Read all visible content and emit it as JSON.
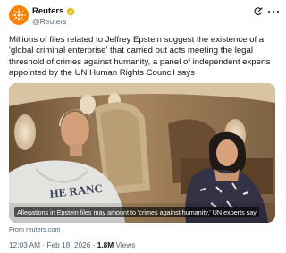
{
  "author": {
    "name": "Reuters",
    "handle": "@Reuters",
    "brand_color": "#ff8000",
    "verified_color": "#e2b719"
  },
  "tweet": {
    "line1": "Millions of files related to Jeffrey Epstein suggest the existence of a",
    "line2": "'global criminal enterprise' that carried out acts meeting the legal",
    "line3": "threshold of crimes against humanity, a panel of independent experts",
    "line4": "appointed by the UN Human Rights Council says"
  },
  "media": {
    "caption": "Allegations in Epstein files may amount to 'crimes against humanity,' UN experts say",
    "source": "From reuters.com",
    "shirt_text": "HE RANC"
  },
  "meta": {
    "time": "12:03 AM",
    "sep1": " · ",
    "date": "Feb 18, 2026",
    "sep2": " · ",
    "views_count": "1.8M",
    "views_label": " Views"
  },
  "icons": [
    "reuters-logo-icon",
    "verified-badge-icon",
    "grok-icon",
    "more-options-icon"
  ]
}
